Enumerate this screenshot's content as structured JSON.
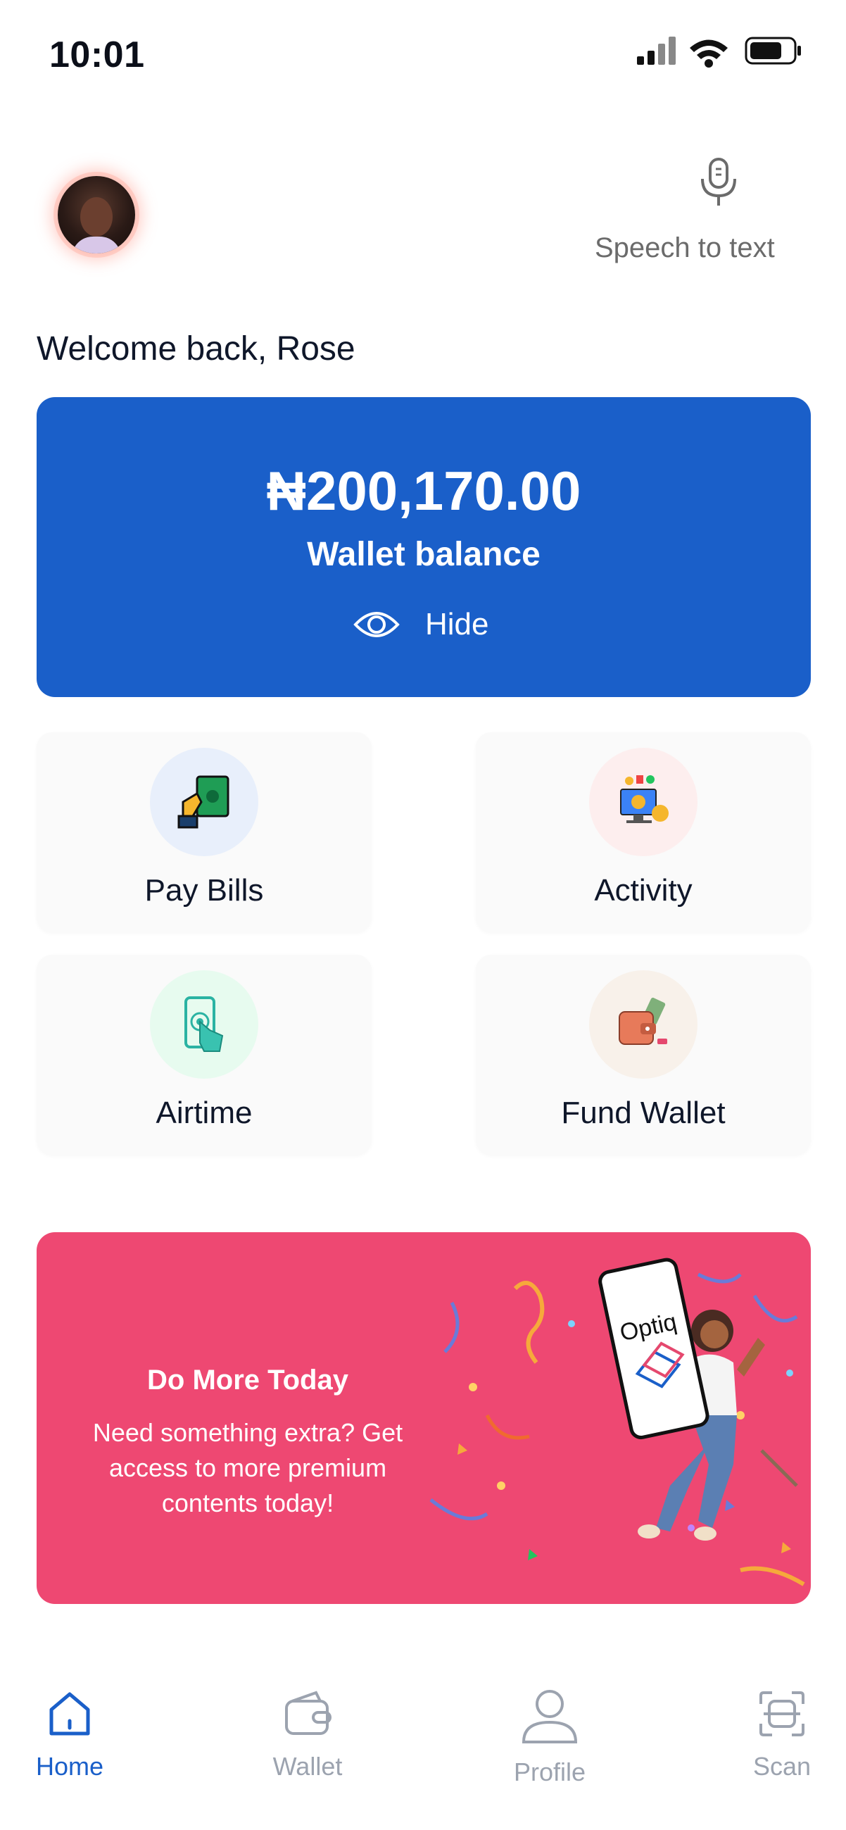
{
  "status_bar": {
    "time": "10:01"
  },
  "header": {
    "speech_label": "Speech to text"
  },
  "welcome": "Welcome back, Rose",
  "wallet": {
    "amount": "₦200,170.00",
    "label": "Wallet balance",
    "hide_label": "Hide"
  },
  "tiles": [
    {
      "label": "Pay Bills",
      "icon": "pay-bills-icon"
    },
    {
      "label": "Activity",
      "icon": "activity-icon"
    },
    {
      "label": "Airtime",
      "icon": "airtime-icon"
    },
    {
      "label": "Fund Wallet",
      "icon": "fund-wallet-icon"
    }
  ],
  "promo": {
    "title": "Do More Today",
    "body": "Need something extra? Get access to more premium contents today!",
    "phone_brand": "Optiq"
  },
  "nav": [
    {
      "label": "Home",
      "icon": "home-icon",
      "active": true
    },
    {
      "label": "Wallet",
      "icon": "wallet-icon"
    },
    {
      "label": "Profile",
      "icon": "profile-icon"
    },
    {
      "label": "Scan",
      "icon": "scan-icon"
    }
  ],
  "colors": {
    "primary": "#1a5fc9",
    "promo": "#ee4872",
    "muted": "#9ca3af"
  }
}
